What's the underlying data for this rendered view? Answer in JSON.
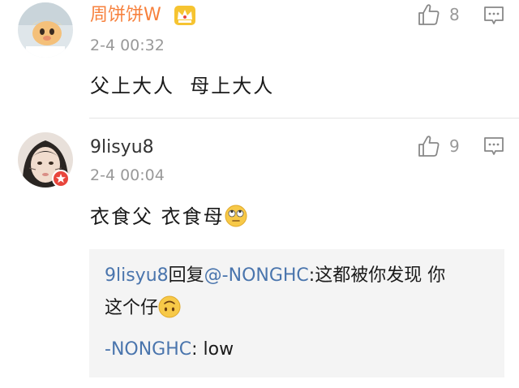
{
  "comments": [
    {
      "username": "周饼饼W",
      "timestamp": "2-4 00:32",
      "likes": "8",
      "text": "父上大人  母上大人",
      "avatar_icon": "cartoon-avatar",
      "badge_icon": "crown-icon"
    },
    {
      "username": "9lisyu8",
      "timestamp": "2-4 00:04",
      "likes": "9",
      "text": "衣食父 衣食母",
      "emoji_icon": "eye-roll-emoji",
      "avatar_icon": "user-avatar",
      "badge_icon": "verified-badge-icon",
      "reply": {
        "line1_user": "9lisyu8",
        "line1_action": "回复",
        "line1_mention": "@-NONGHC",
        "line1_text": ":这都被你发现 你",
        "line2_text": "这个仔",
        "line2_emoji": "upside-down-face-emoji",
        "line3_user": "-NONGHC",
        "line3_text": ": low"
      }
    }
  ],
  "colors": {
    "vip_username": "#f7813d",
    "link": "#4a75ad",
    "meta_gray": "#999999",
    "reply_bg": "#f4f4f4"
  }
}
